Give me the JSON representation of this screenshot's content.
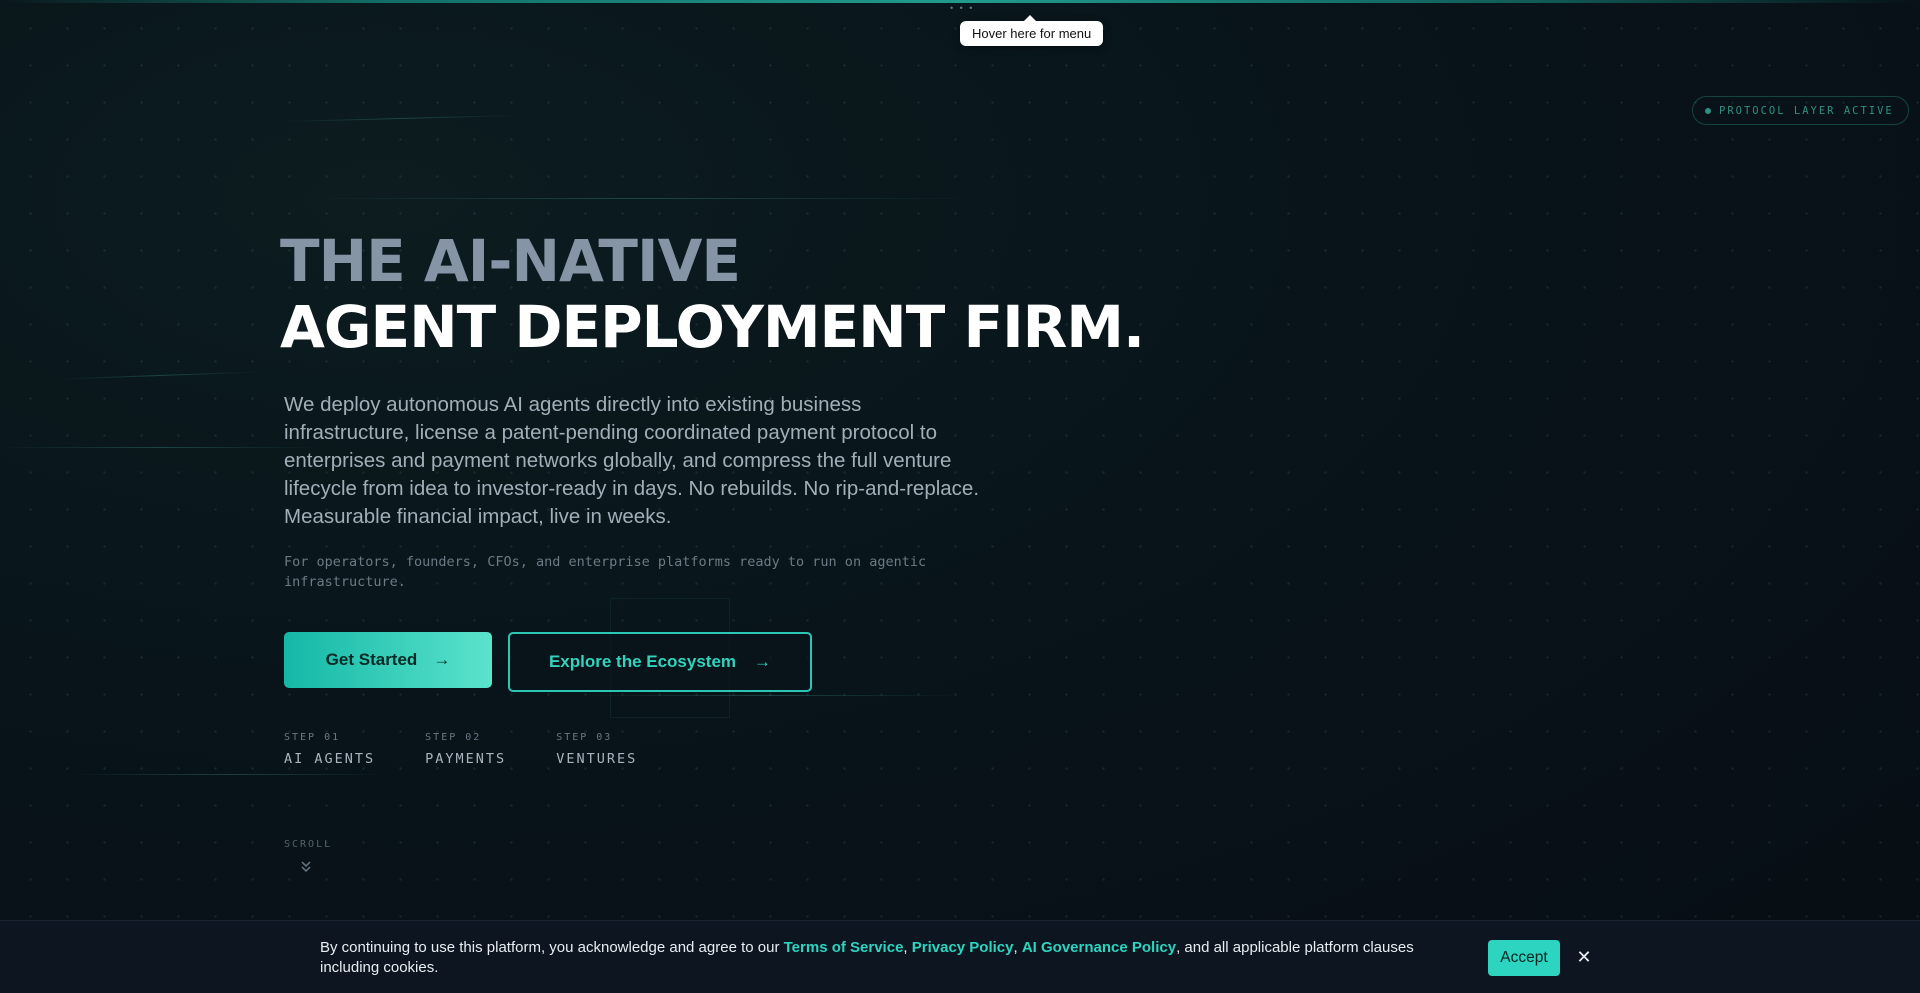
{
  "menu": {
    "trigger_label": "• • •",
    "tooltip": "Hover here for menu"
  },
  "badge": {
    "label": "PROTOCOL LAYER ACTIVE"
  },
  "hero": {
    "headline_line1": "THE AI-NATIVE",
    "headline_line2": "AGENT DEPLOYMENT FIRM.",
    "description": "We deploy autonomous AI agents directly into existing business infrastructure, license a patent-pending coordinated payment protocol to enterprises and payment networks globally, and compress the full venture lifecycle from idea to investor-ready in days. No rebuilds. No rip-and-replace. Measurable financial impact, live in weeks.",
    "subnote": "For operators, founders, CFOs, and enterprise platforms ready to run on agentic infrastructure.",
    "primary_cta": "Get Started",
    "secondary_cta": "Explore the Ecosystem",
    "arrow_icon": "→"
  },
  "steps": [
    {
      "number": "STEP 01",
      "name": "AI AGENTS"
    },
    {
      "number": "STEP 02",
      "name": "PAYMENTS"
    },
    {
      "number": "STEP 03",
      "name": "VENTURES"
    }
  ],
  "scroll": {
    "label": "SCROLL",
    "icon": "double-chevron-down-icon",
    "glyph": "⌄"
  },
  "cookie": {
    "prefix": "By continuing to use this platform, you acknowledge and agree to our ",
    "terms": "Terms of Service",
    "sep1": ", ",
    "privacy": "Privacy Policy",
    "sep2": ", ",
    "ai_policy": "AI Governance Policy",
    "suffix": ", and all applicable platform clauses including cookies.",
    "accept": "Accept",
    "close_glyph": "✕"
  },
  "colors": {
    "accent": "#2dd4bf",
    "background": "#08141a",
    "headline_muted": "#8595a6"
  }
}
